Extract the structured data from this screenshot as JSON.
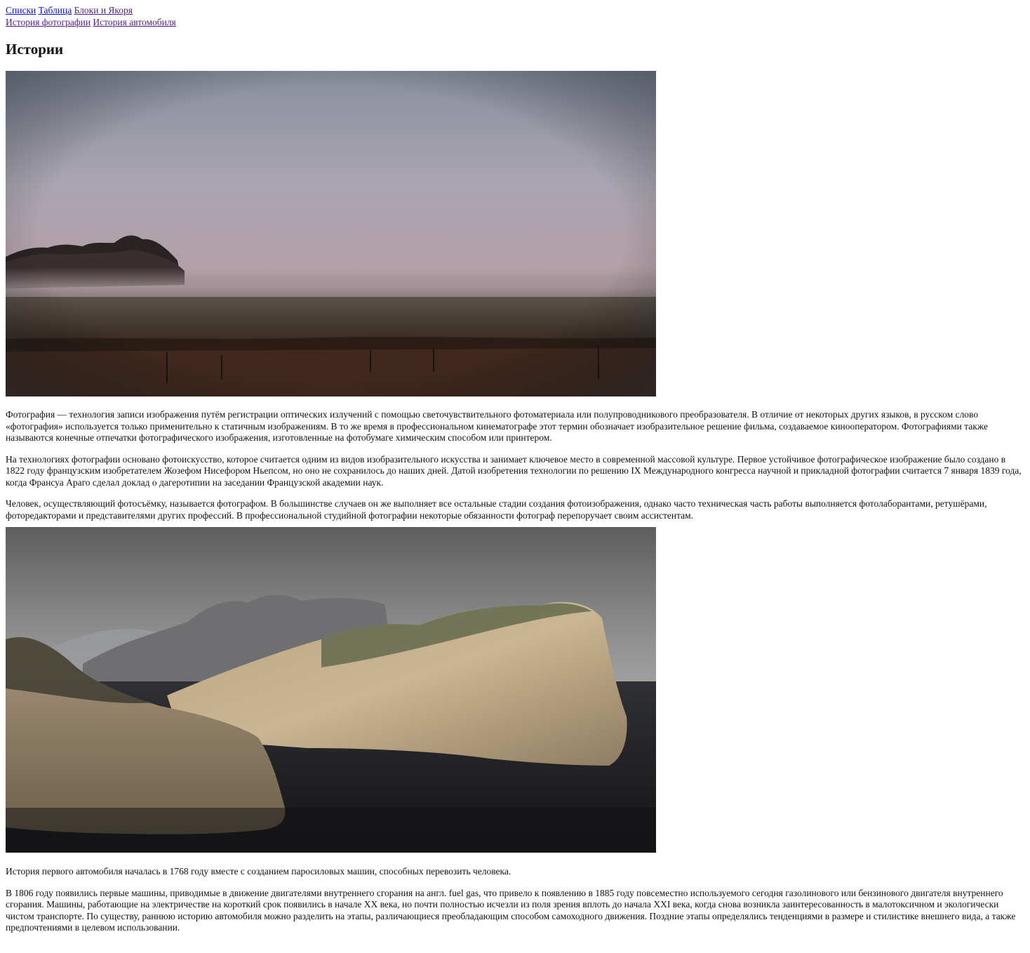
{
  "nav": {
    "row1": [
      "Списки",
      "Таблица",
      "Блоки и Якоря"
    ],
    "row2": [
      "История фотографии",
      "История автомобиля"
    ]
  },
  "page_title": "Истории",
  "photo_section": {
    "paragraphs": [
      "Фотография — технология записи изображения путём регистрации оптических излучений с помощью светочувствительного фотоматериала или полупроводникового преобразователя. В отличие от некоторых других языков, в русском слово «фотография» используется только применительно к статичным изображениям. В то же время в профессиональном кинематографе этот термин обозначает изобразительное решение фильма, создаваемое кинооператором. Фотографиями также называются конечные отпечатки фотографического изображения, изготовленные на фотобумаге химическим способом или принтером.",
      "На технологиях фотографии основано фотоискусство, которое считается одним из видов изобразительного искусства и занимает ключевое место в современной массовой культуре. Первое устойчивое фотографическое изображение было создано в 1822 году французским изобретателем Жозефом Нисефором Ньепсом, но оно не сохранилось до наших дней. Датой изобретения технологии по решению IX Международного конгресса научной и прикладной фотографии считается 7 января 1839 года, когда Франсуа Араго сделал доклад о дагеротипии на заседании Французской академии наук.",
      "Человек, осуществляющий фотосъёмку, называется фотографом. В большинстве случаев он же выполняет все остальные стадии создания фотоизображения, однако часто техническая часть работы выполняется фотолаборантами, ретушёрами, фоторедакторами и представителями других профессий. В профессиональной студийной фотографии некоторые обязанности фотограф перепоручает своим ассистентам."
    ]
  },
  "car_section": {
    "paragraphs": [
      "История первого автомобиля началась в 1768 году вместе с созданием паросиловых машин, способных перевозить человека.",
      "В 1806 году появились первые машины, приводимые в движение двигателями внутреннего сгорания на англ. fuel gas, что привело к появлению в 1885 году повсеместно используемого сегодня газолинового или бензинового двигателя внутреннего сгорания. Машины, работающие на электричестве на короткий срок появились в начале XX века, но почти полностью исчезли из поля зрения вплоть до начала XXI века, когда снова возникла заинтересованность в малотоксичном и экологически чистом транспорте. По существу, раннюю историю автомобиля можно разделить на этапы, различающиеся преобладающим способом самоходного движения. Поздние этапы определялись тенденциями в размере и стилистике внешнего вида, а также предпочтениями в целевом использовании."
    ]
  }
}
